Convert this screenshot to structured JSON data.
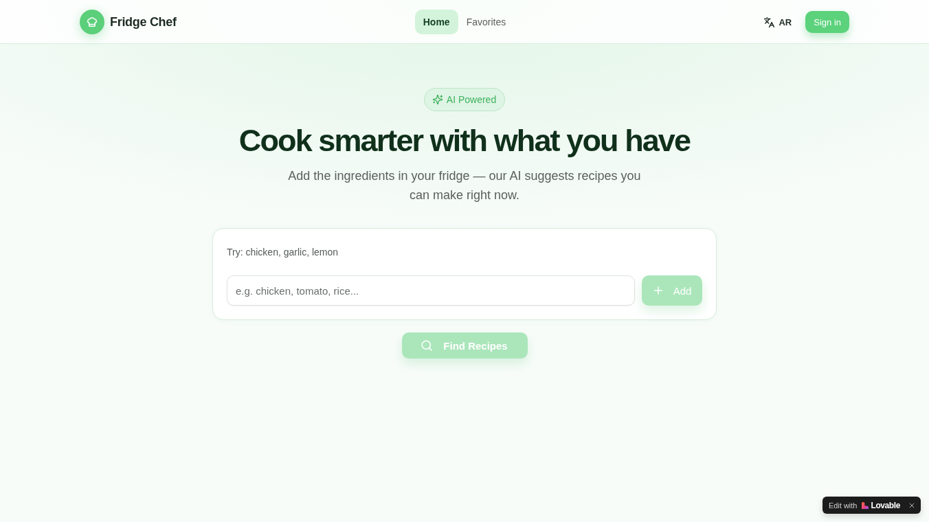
{
  "header": {
    "brand": {
      "title": "Fridge Chef"
    },
    "nav": [
      {
        "label": "Home",
        "selected": true
      },
      {
        "label": "Favorites",
        "selected": false
      }
    ],
    "language_button": {
      "label": "AR"
    },
    "sign_in_button": {
      "label": "Sign in"
    }
  },
  "hero": {
    "badge": "AI Powered",
    "title": "Cook smarter with what you have",
    "subtitle": "Add the ingredients in your fridge — our AI suggests recipes you can make right now."
  },
  "ingredient_card": {
    "suggestion": "Try: chicken, garlic, lemon",
    "input": {
      "placeholder": "e.g. chicken, tomato, rice..."
    },
    "add_button": {
      "label": "Add",
      "disabled": true
    }
  },
  "find_button": {
    "label": "Find Recipes",
    "disabled": true
  },
  "edit_badge": {
    "label": "Edit with",
    "brand": "Lovable"
  }
}
